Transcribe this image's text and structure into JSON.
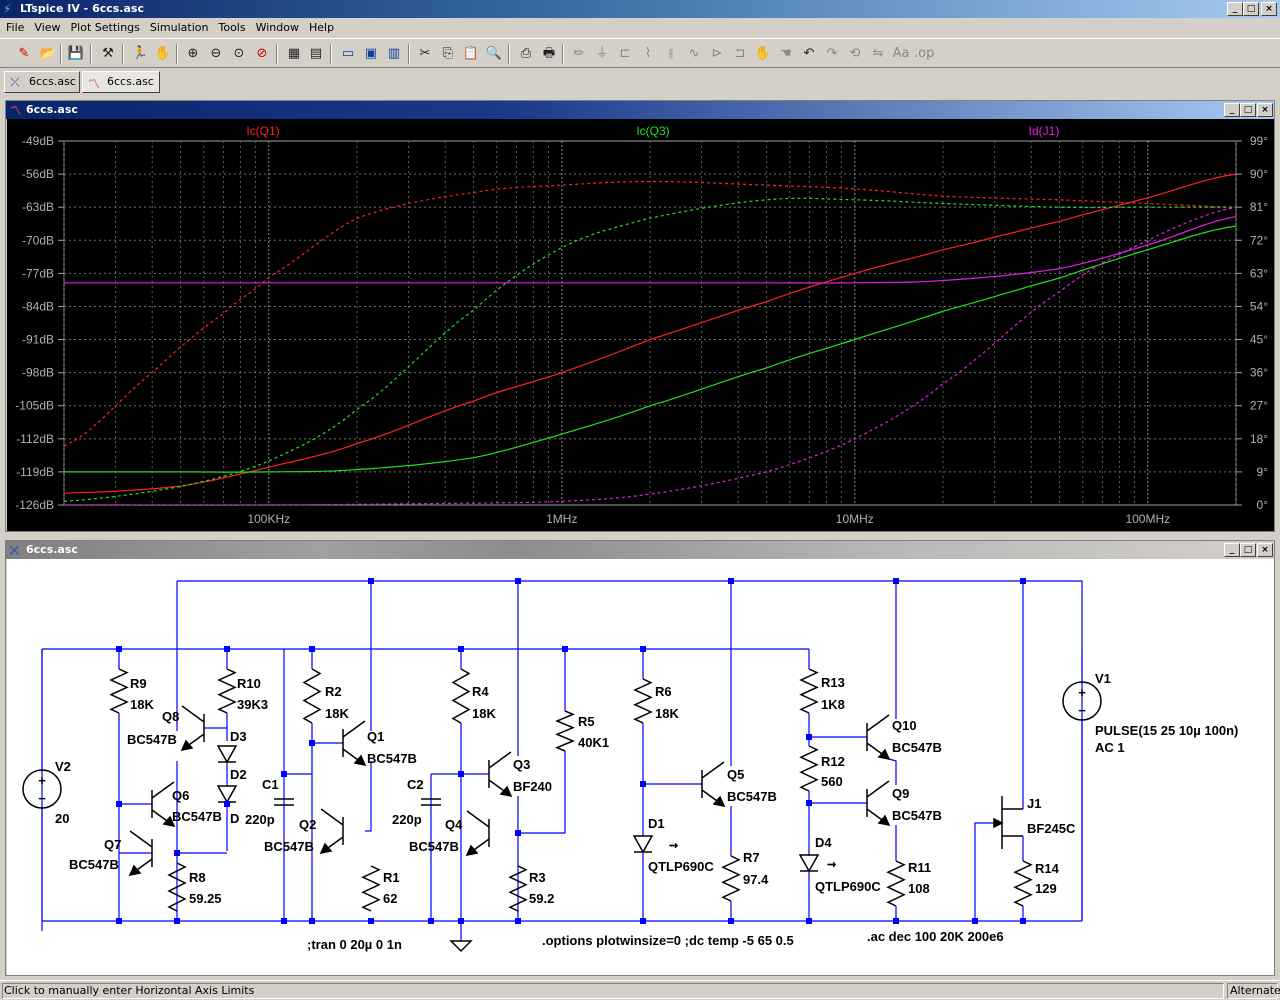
{
  "app": {
    "title": "LTspice IV - 6ccs.asc"
  },
  "menu": [
    "File",
    "View",
    "Plot Settings",
    "Simulation",
    "Tools",
    "Window",
    "Help"
  ],
  "tabs": [
    {
      "label": "6ccs.asc",
      "icon": "schematic-icon"
    },
    {
      "label": "6ccs.asc",
      "icon": "waveform-icon"
    }
  ],
  "plot_window": {
    "title": "6ccs.asc"
  },
  "schematic_window": {
    "title": "6ccs.asc"
  },
  "colors": {
    "bg": "#000000",
    "grid": "#808080",
    "axis_text": "#b0b0b0",
    "ic_q1": "#ff2020",
    "ic_q3": "#20e020",
    "id_j1": "#e020e0",
    "wire": "#0000ff",
    "component": "#000000"
  },
  "chart_data": {
    "type": "line",
    "xscale": "log",
    "xlim": [
      20000,
      200000000
    ],
    "xticks": [
      "100KHz",
      "1MHz",
      "10MHz",
      "100MHz"
    ],
    "xtick_values": [
      100000,
      1000000,
      10000000,
      100000000
    ],
    "ylim_left": [
      -126,
      -49
    ],
    "yticks_left": [
      "-49dB",
      "-56dB",
      "-63dB",
      "-70dB",
      "-77dB",
      "-84dB",
      "-91dB",
      "-98dB",
      "-105dB",
      "-112dB",
      "-119dB",
      "-126dB"
    ],
    "ylim_right": [
      0,
      99
    ],
    "yticks_right": [
      "99°",
      "90°",
      "81°",
      "72°",
      "63°",
      "54°",
      "45°",
      "36°",
      "27°",
      "18°",
      "9°",
      "0°"
    ],
    "grid": true,
    "legend": "top",
    "series": [
      {
        "name": "Ic(Q1)",
        "color": "#ff2020",
        "kind": "magnitude",
        "x": [
          20000,
          50000,
          100000,
          200000,
          500000,
          1000000,
          2000000,
          5000000,
          10000000,
          20000000,
          50000000,
          100000000,
          200000000
        ],
        "y": [
          -123.5,
          -122,
          -118,
          -113,
          -104,
          -98,
          -91,
          -83,
          -77,
          -72,
          -66,
          -61,
          -56
        ]
      },
      {
        "name": "Ic(Q1)",
        "color": "#ff2020",
        "kind": "phase",
        "x": [
          20000,
          40000,
          70000,
          100000,
          200000,
          500000,
          1000000,
          2000000,
          5000000,
          10000000,
          20000000,
          50000000,
          100000000,
          200000000
        ],
        "y": [
          16,
          36,
          52,
          62,
          78,
          85,
          87,
          88,
          87,
          86,
          84,
          83,
          82,
          81
        ]
      },
      {
        "name": "Ic(Q3)",
        "color": "#20e020",
        "kind": "magnitude",
        "x": [
          20000,
          50000,
          100000,
          200000,
          500000,
          1000000,
          2000000,
          5000000,
          10000000,
          20000000,
          50000000,
          100000000,
          200000000
        ],
        "y": [
          -119,
          -119,
          -119,
          -118.5,
          -116,
          -111,
          -105,
          -97,
          -91,
          -85,
          -78,
          -72,
          -67
        ]
      },
      {
        "name": "Ic(Q3)",
        "color": "#20e020",
        "kind": "phase",
        "x": [
          20000,
          50000,
          100000,
          200000,
          500000,
          1000000,
          2000000,
          5000000,
          10000000,
          20000000,
          50000000,
          100000000,
          200000000
        ],
        "y": [
          1,
          5,
          12,
          26,
          53,
          70,
          78,
          83,
          83,
          82,
          81,
          81,
          81
        ]
      },
      {
        "name": "Id(J1)",
        "color": "#e020e0",
        "kind": "magnitude",
        "x": [
          20000,
          100000,
          1000000,
          5000000,
          10000000,
          20000000,
          50000000,
          100000000,
          200000000
        ],
        "y": [
          -79,
          -79,
          -79,
          -79,
          -79,
          -78.5,
          -76,
          -71,
          -65
        ]
      },
      {
        "name": "Id(J1)",
        "color": "#e020e0",
        "kind": "phase",
        "x": [
          20000,
          100000,
          500000,
          1000000,
          2000000,
          5000000,
          10000000,
          20000000,
          50000000,
          100000000,
          200000000
        ],
        "y": [
          0,
          0,
          0.5,
          1,
          3,
          9,
          18,
          33,
          58,
          72,
          81
        ]
      }
    ]
  },
  "schematic": {
    "components": [
      {
        "ref": "V2",
        "value": "20"
      },
      {
        "ref": "R9",
        "value": "18K"
      },
      {
        "ref": "R10",
        "value": "39K3"
      },
      {
        "ref": "Q8",
        "value": "BC547B"
      },
      {
        "ref": "D3",
        "value": ""
      },
      {
        "ref": "D2",
        "value": "D"
      },
      {
        "ref": "Q6",
        "value": "BC547B"
      },
      {
        "ref": "Q7",
        "value": "BC547B"
      },
      {
        "ref": "R8",
        "value": "59.25"
      },
      {
        "ref": "C1",
        "value": "220p"
      },
      {
        "ref": "R2",
        "value": "18K"
      },
      {
        "ref": "Q1",
        "value": "BC547B"
      },
      {
        "ref": "Q2",
        "value": "BC547B"
      },
      {
        "ref": "R1",
        "value": "62"
      },
      {
        "ref": "C2",
        "value": "220p"
      },
      {
        "ref": "R4",
        "value": "18K"
      },
      {
        "ref": "Q3",
        "value": "BF240"
      },
      {
        "ref": "Q4",
        "value": "BC547B"
      },
      {
        "ref": "R3",
        "value": "59.2"
      },
      {
        "ref": "R5",
        "value": "40K1"
      },
      {
        "ref": "R6",
        "value": "18K"
      },
      {
        "ref": "Q5",
        "value": "BC547B"
      },
      {
        "ref": "D1",
        "value": "QTLP690C"
      },
      {
        "ref": "R7",
        "value": "97.4"
      },
      {
        "ref": "R13",
        "value": "1K8"
      },
      {
        "ref": "R12",
        "value": "560"
      },
      {
        "ref": "Q10",
        "value": "BC547B"
      },
      {
        "ref": "Q9",
        "value": "BC547B"
      },
      {
        "ref": "D4",
        "value": "QTLP690C"
      },
      {
        "ref": "R11",
        "value": "108"
      },
      {
        "ref": "V1",
        "value": "PULSE(15 25 10µ 100n)",
        "value2": "AC 1"
      },
      {
        "ref": "J1",
        "value": "BF245C"
      },
      {
        "ref": "R14",
        "value": "129"
      }
    ],
    "directives": [
      ";tran 0 20µ 0 1n",
      ".options plotwinsize=0  ;dc temp -5 65 0.5",
      ".ac dec 100 20K 200e6"
    ]
  },
  "status": {
    "left": "Click to manually enter Horizontal Axis Limits",
    "right": "Alternate"
  }
}
